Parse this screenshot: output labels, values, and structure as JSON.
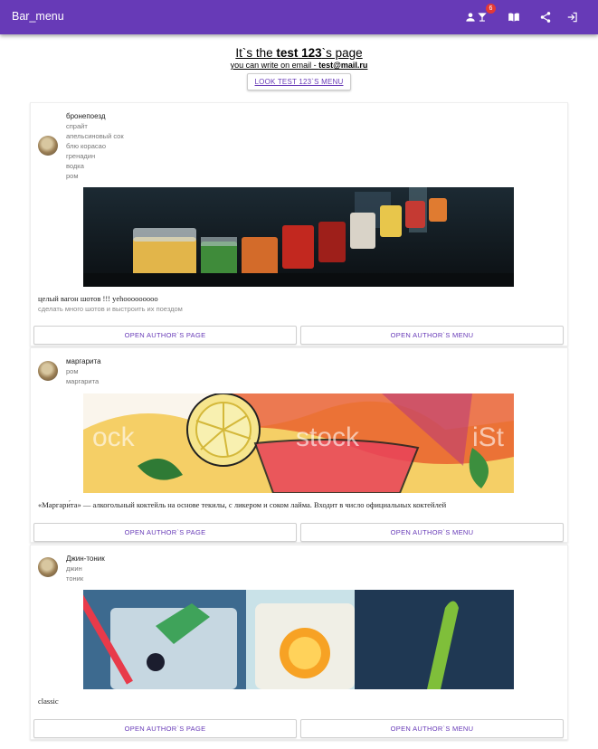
{
  "appbar": {
    "title": "Bar_menu",
    "badge_count": "6",
    "icons": [
      "person-icon",
      "cocktail-icon",
      "menu-book-icon",
      "share-icon",
      "login-icon"
    ],
    "color": "#673ab7"
  },
  "header": {
    "title_prefix": "It`s the ",
    "title_name": "test 123",
    "title_suffix": "`s page",
    "email_prefix": "you can write on email - ",
    "email_user": "test",
    "email_domain": "@mail.ru",
    "look_button": "LOOK TEST 123`S MENU"
  },
  "cards": [
    {
      "name": "бронепоезд",
      "ingredients": [
        "спрайт",
        "апельсиновый сок",
        "блю корасао",
        "гренадин",
        "водка",
        "ром"
      ],
      "description": "целый вагон шотов !!! yehooooooooo",
      "subtitle": "сделать много шотов и выстроить их поездом",
      "author_button": "OPEN AUTHOR`S PAGE",
      "menu_button": "OPEN AUTHOR`S MENU"
    },
    {
      "name": "маргарита",
      "ingredients": [
        "ром",
        "маргарита"
      ],
      "description": "«Маргари́та» — алкогольный коктейль на основе текилы, с ликером и соком лайма. Входит в число официальных коктейлей",
      "subtitle": "",
      "author_button": "OPEN AUTHOR`S PAGE",
      "menu_button": "OPEN AUTHOR`S MENU"
    },
    {
      "name": "Джин-тоник",
      "ingredients": [
        "джин",
        "тоник"
      ],
      "description": "classic",
      "subtitle": "",
      "author_button": "OPEN AUTHOR`S PAGE",
      "menu_button": "OPEN AUTHOR`S MENU"
    }
  ]
}
